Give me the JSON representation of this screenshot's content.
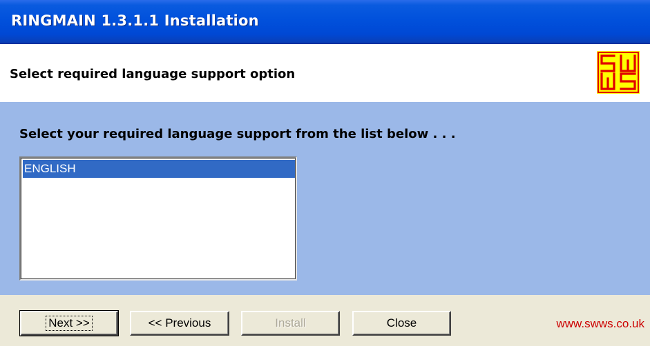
{
  "window": {
    "title": "RINGMAIN 1.3.1.1 Installation"
  },
  "header": {
    "title": "Select required language support option",
    "logo": {
      "line1": "SW",
      "line2": "WS",
      "bg_color": "#ffff00",
      "fg_color": "#e00000"
    }
  },
  "content": {
    "instruction": "Select your required language support from the list below . . .",
    "languages": [
      {
        "label": "ENGLISH",
        "selected": true
      }
    ]
  },
  "footer": {
    "next_label": "Next >>",
    "previous_label": "<< Previous",
    "install_label": "Install",
    "close_label": "Close",
    "install_enabled": false,
    "website": "www.swws.co.uk"
  },
  "colors": {
    "title_bar": "#0151dc",
    "content_bg": "#9bb8e8",
    "selection": "#316ac5",
    "website_text": "#cc0000"
  }
}
